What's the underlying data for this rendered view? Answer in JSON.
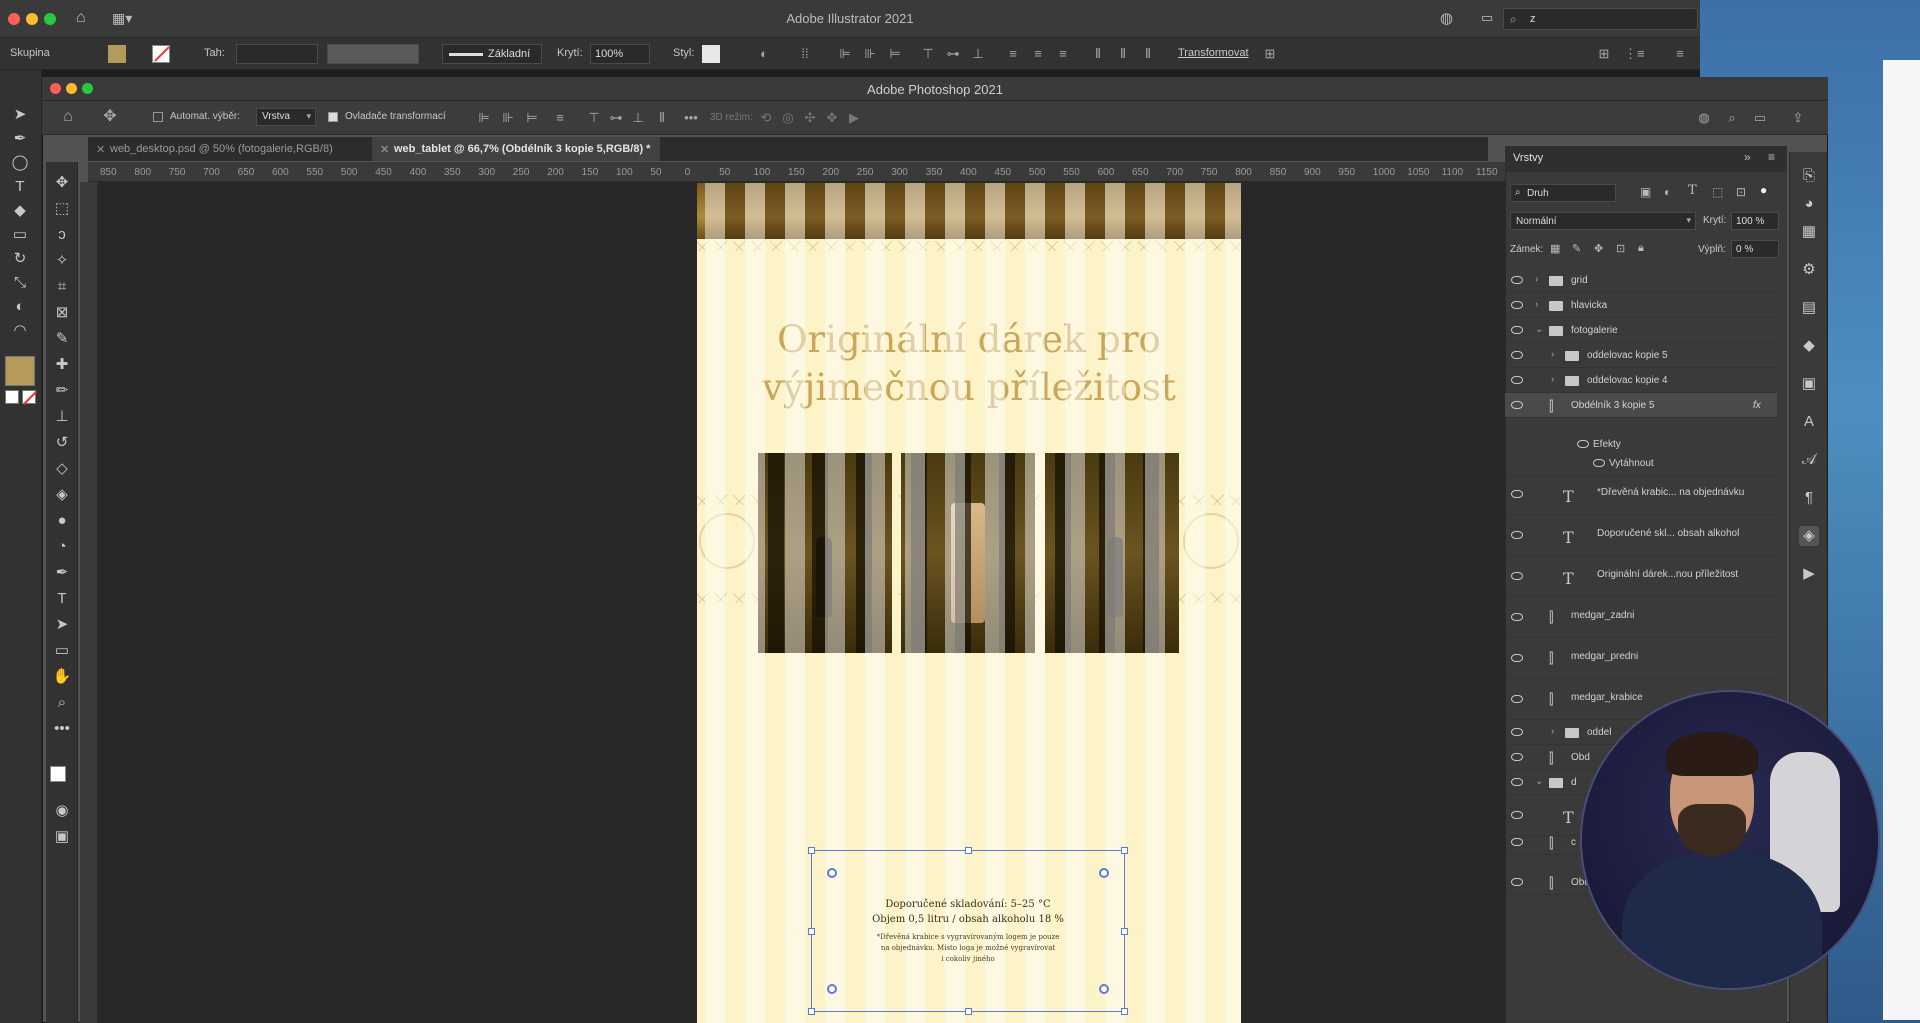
{
  "illustrator": {
    "title": "Adobe Illustrator 2021",
    "controlbar": {
      "group_label": "Skupina",
      "stroke_label": "Tah:",
      "stroke_style": "Základní",
      "opacity_label": "Krytí:",
      "opacity_value": "100%",
      "style_label": "Styl:",
      "transform_label": "Transformovat",
      "search_value": "z"
    }
  },
  "photoshop": {
    "title": "Adobe Photoshop 2021",
    "options": {
      "auto_select_label": "Automat. výběr:",
      "auto_select_value": "Vrstva",
      "transform_controls_label": "Ovladače transformací",
      "mode_3d_label": "3D režim:"
    },
    "tabs": [
      {
        "label": "web_desktop.psd @ 50% (fotogalerie,RGB/8)"
      },
      {
        "label": "web_tablet @ 66,7% (Obdélník 3 kopie 5,RGB/8) *"
      }
    ],
    "ruler_h": [
      "850",
      "800",
      "750",
      "700",
      "650",
      "600",
      "550",
      "500",
      "450",
      "400",
      "350",
      "300",
      "250",
      "200",
      "150",
      "100",
      "50",
      "0",
      "50",
      "100",
      "150",
      "200",
      "250",
      "300",
      "350",
      "400",
      "450",
      "500",
      "550",
      "600",
      "650",
      "700",
      "750",
      "800",
      "850",
      "900",
      "950",
      "1000",
      "1050",
      "1100",
      "1150"
    ]
  },
  "artboard": {
    "headline_line1": "Originální dárek pro",
    "headline_line2": "výjimečnou příležitost",
    "storage_line1": "Doporučené skladování: 5–25 °C",
    "storage_line2": "Objem 0,5 litru / obsah alkoholu 18 %",
    "note_line1": "*Dřevěná krabice s vygravírovaným logem je pouze",
    "note_line2": "na objednávku. Místo loga je možné vygravírovat",
    "note_line3": "i cokoliv jiného"
  },
  "layers_panel": {
    "tab_label": "Vrstvy",
    "filter_kind": "Druh",
    "blend_mode": "Normální",
    "opacity_label": "Krytí:",
    "opacity_value": "100 %",
    "lock_label": "Zámek:",
    "fill_label": "Výplň:",
    "fill_value": "0 %",
    "layers": [
      {
        "name": "grid",
        "kind": "folder"
      },
      {
        "name": "hlavicka",
        "kind": "folder"
      },
      {
        "name": "fotogalerie",
        "kind": "folder-open"
      },
      {
        "name": "oddelovac kopie 5",
        "kind": "folder"
      },
      {
        "name": "oddelovac kopie 4",
        "kind": "folder"
      },
      {
        "name": "Obdélník 3 kopie 5",
        "kind": "shape",
        "fx": "fx"
      },
      {
        "name": "Efekty",
        "kind": "effects"
      },
      {
        "name": "Vytáhnout",
        "kind": "effect"
      },
      {
        "name": "*Dřevěná krabic... na objednávku",
        "kind": "text"
      },
      {
        "name": "Doporučené skl... obsah alkohol",
        "kind": "text"
      },
      {
        "name": "Originální dárek...nou příležitost",
        "kind": "text"
      },
      {
        "name": "medgar_zadni",
        "kind": "smart"
      },
      {
        "name": "medgar_predni",
        "kind": "smart"
      },
      {
        "name": "medgar_krabice",
        "kind": "smart"
      },
      {
        "name": "oddel",
        "kind": "folder"
      },
      {
        "name": "Obd",
        "kind": "shape"
      },
      {
        "name": "d",
        "kind": "folder-open"
      },
      {
        "name": "",
        "kind": "text"
      },
      {
        "name": "c",
        "kind": "shape"
      },
      {
        "name": "Obdéln",
        "kind": "shape"
      }
    ]
  },
  "colors": {
    "artboard_bg": "#fdf3c8",
    "headline": "#c9a65c",
    "selection": "#5b7bd6"
  }
}
